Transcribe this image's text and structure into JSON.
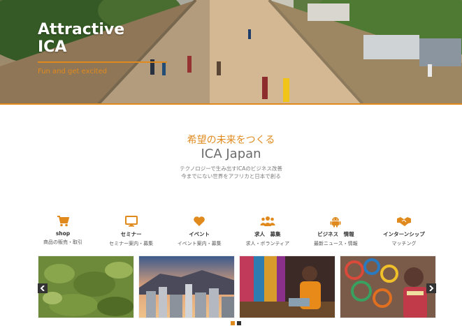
{
  "hero": {
    "title_line1": "Attractive",
    "title_line2": "ICA",
    "subtitle": "Fun and get excited"
  },
  "intro": {
    "headline": "希望の未来をつくる",
    "title": "ICA Japan",
    "desc_line1": "テクノロジーで生み出すICAのビジネス改善",
    "desc_line2": "今までにない世界をアフリカと日本で創る"
  },
  "features": [
    {
      "icon": "cart-icon",
      "label": "shop",
      "desc": "商品の販売・取引"
    },
    {
      "icon": "monitor-icon",
      "label": "セミナー",
      "desc": "セミナー案内・募集"
    },
    {
      "icon": "heart-icon",
      "label": "イベント",
      "desc": "イベント案内・募集"
    },
    {
      "icon": "people-icon",
      "label": "求人　募集",
      "desc": "求人・ボランティア"
    },
    {
      "icon": "android-icon",
      "label": "ビジネス　情報",
      "desc": "最新ニュース・情報"
    },
    {
      "icon": "handshake-icon",
      "label": "インターンシップ",
      "desc": "マッチング"
    }
  ],
  "carousel": {
    "slides": [
      "dried-leaves-image",
      "city-skyline-image",
      "artisan-woman-image",
      "market-beads-image"
    ],
    "active_dot": 1,
    "dot_count": 2
  },
  "colors": {
    "accent": "#e08a1e",
    "text_dark": "#333333",
    "text_muted": "#6b6b6b"
  }
}
